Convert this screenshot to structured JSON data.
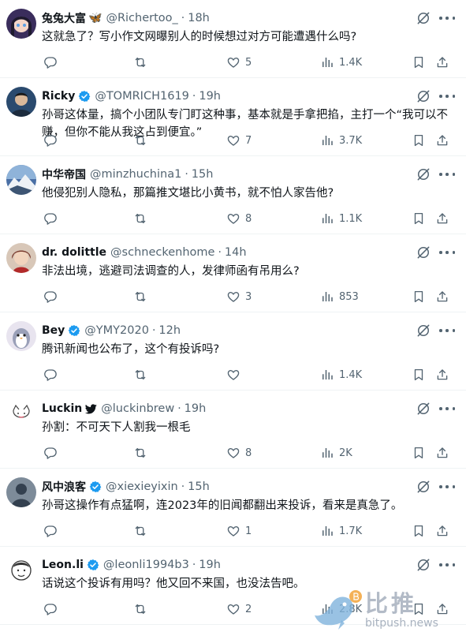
{
  "colors": {
    "text": "#0f1419",
    "muted": "#536471",
    "verified": "#1d9bf0",
    "divider": "#eff3f4"
  },
  "icons": {
    "reply": "comment-icon",
    "retweet": "retweet-icon",
    "like": "heart-icon",
    "views": "views-icon",
    "bookmark": "bookmark-icon",
    "share": "share-icon",
    "grok": "grok-icon",
    "more": "more-icon"
  },
  "tweets": [
    {
      "name": "兔兔大富",
      "emoji": "🦋",
      "verified": false,
      "handle": "@Richertoo_",
      "time": "18h",
      "text": "这就急了？写小作文网曝别人的时候想过对方可能遭遇什么吗?",
      "replies": "",
      "retweets": "",
      "likes": "5",
      "views": "1.4K",
      "avatar_color": "#3a2d5c"
    },
    {
      "name": "Ricky",
      "emoji": "",
      "verified": true,
      "handle": "@TOMRICH1619",
      "time": "19h",
      "text": "孙哥这体量，搞个小团队专门盯这种事，基本就是手拿把掐，主打一个“我可以不赚，但你不能从我这占到便宜。”",
      "replies": "",
      "retweets": "",
      "likes": "7",
      "views": "3.7K",
      "avatar_color": "#2a4a6e"
    },
    {
      "name": "中华帝国",
      "emoji": "",
      "verified": false,
      "handle": "@minzhuchina1",
      "time": "15h",
      "text": "他侵犯别人隐私，那篇推文堪比小黄书，就不怕人家告他?",
      "replies": "",
      "retweets": "",
      "likes": "8",
      "views": "1.1K",
      "avatar_color": "#4a6fa5"
    },
    {
      "name": "dr. dolittle",
      "emoji": "",
      "verified": false,
      "handle": "@schneckenhome",
      "time": "14h",
      "text": "非法出境，逃避司法调查的人，发律师函有吊用么?",
      "replies": "",
      "retweets": "",
      "likes": "3",
      "views": "853",
      "avatar_color": "#7a3b2e"
    },
    {
      "name": "Bey",
      "emoji": "",
      "verified": true,
      "handle": "@YMY2020",
      "time": "12h",
      "text": "腾讯新闻也公布了，这个有投诉吗?",
      "replies": "",
      "retweets": "",
      "likes": "",
      "views": "1.4K",
      "avatar_color": "#e8e4ef"
    },
    {
      "name": "Luckin",
      "emoji": "",
      "verified": false,
      "bird": true,
      "handle": "@luckinbrew",
      "time": "19h",
      "text": "孙割：不可天下人割我一根毛",
      "replies": "",
      "retweets": "",
      "likes": "8",
      "views": "2K",
      "avatar_color": "#ffffff"
    },
    {
      "name": "风中浪客",
      "emoji": "",
      "verified": true,
      "handle": "@xiexieyixin",
      "time": "15h",
      "text": "孙哥这操作有点猛啊，连2023年的旧闻都翻出来投诉，看来是真急了。",
      "replies": "",
      "retweets": "",
      "likes": "1",
      "views": "1.7K",
      "avatar_color": "#33404f"
    },
    {
      "name": "Leon.li",
      "emoji": "",
      "verified": true,
      "handle": "@leonli1994b3",
      "time": "19h",
      "text": "话说这个投诉有用吗？他又回不来国，也没法告吧。",
      "replies": "",
      "retweets": "",
      "likes": "2",
      "views": "2.8K",
      "avatar_color": "#ffffff"
    }
  ],
  "watermark": {
    "cn": "比推",
    "en": "bitpush.news"
  }
}
